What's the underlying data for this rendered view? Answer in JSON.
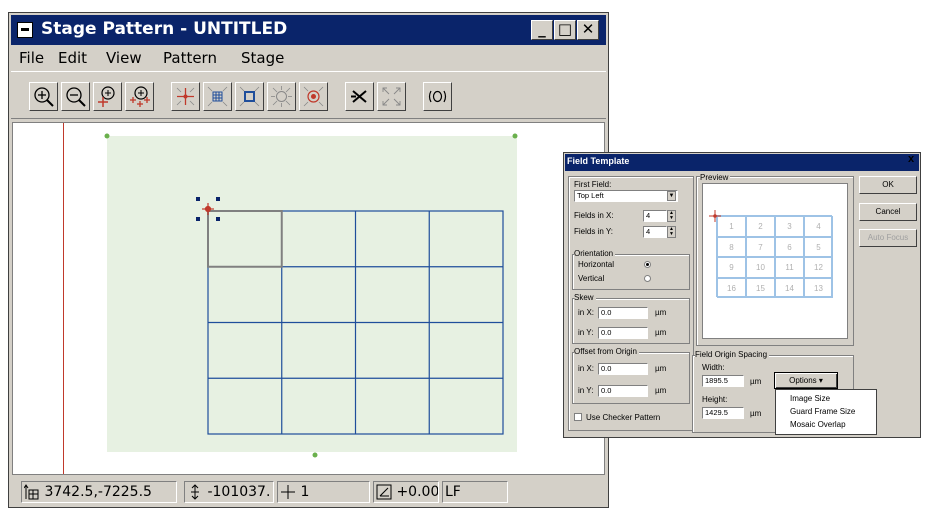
{
  "main_window": {
    "title": "Stage Pattern - UNTITLED",
    "caption_buttons": {
      "minimize": "_",
      "maximize": "□",
      "close": "✕"
    }
  },
  "menu": [
    "File",
    "Edit",
    "View",
    "Pattern",
    "Stage"
  ],
  "toolbar": {
    "buttons": [
      "zoom-in-icon",
      "zoom-out-icon",
      "zoom-point-icon",
      "zoom-all-icon",
      "crosshair-icon",
      "grid-icon",
      "box-icon",
      "circle-pattern-icon",
      "target-icon",
      "cut-icon",
      "expand-icon",
      "stage-ring-icon"
    ]
  },
  "status_bar": {
    "position": "3742.5,-7225.5",
    "z_value": "-101037.",
    "field": "1",
    "angle": "+0.00°",
    "mode": "LF"
  },
  "colors": {
    "title_bar": "#0a246a",
    "stage_fill": "#e7f1e2",
    "grid_line": "#1f4e9b",
    "origin_marker": "#c0392b",
    "handle": "#0a246a",
    "corner_dot": "#6ab04c"
  },
  "field_template": {
    "title": "Field Template",
    "close_glyph": "x",
    "first_field_label": "First Field:",
    "first_field_value": "Top Left",
    "fields_in_x_label": "Fields in X:",
    "fields_in_x_value": "4",
    "fields_in_y_label": "Fields in Y:",
    "fields_in_y_value": "4",
    "orientation_label": "Orientation",
    "horizontal_label": "Horizontal",
    "vertical_label": "Vertical",
    "orientation_selected": "Horizontal",
    "skew_label": "Skew",
    "skew_x_label": "in X:",
    "skew_x_value": "0.0",
    "skew_y_label": "in Y:",
    "skew_y_value": "0.0",
    "offset_label": "Offset from Origin",
    "offset_x_label": "in X:",
    "offset_x_value": "0.0",
    "offset_y_label": "in Y:",
    "offset_y_value": "0.0",
    "unit": "µm",
    "checker_label": "Use Checker Pattern",
    "preview_label": "Preview",
    "preview_cells": [
      "1",
      "2",
      "3",
      "4",
      "8",
      "7",
      "6",
      "5",
      "9",
      "10",
      "11",
      "12",
      "16",
      "15",
      "14",
      "13"
    ],
    "spacing_label": "Field Origin Spacing",
    "width_label": "Width:",
    "width_value": "1895.5",
    "height_label": "Height:",
    "height_value": "1429.5",
    "ok_label": "OK",
    "cancel_label": "Cancel",
    "autofocus_label": "Auto Focus",
    "options_label": "Options ▾",
    "options_menu": [
      "Image Size",
      "Guard Frame Size",
      "Mosaic Overlap"
    ]
  }
}
